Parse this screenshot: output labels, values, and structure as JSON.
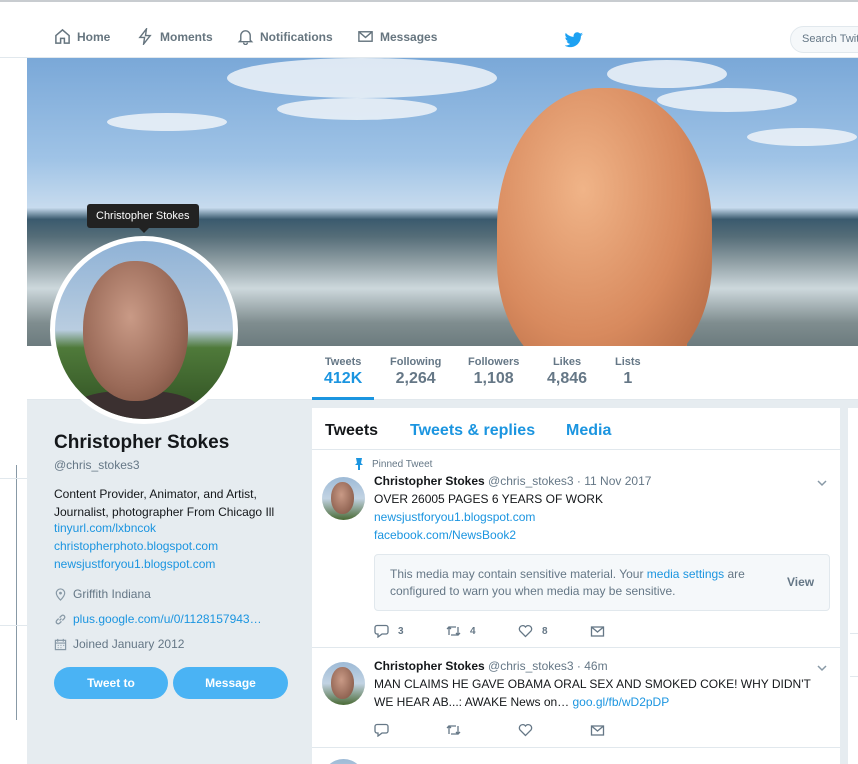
{
  "nav": {
    "home": "Home",
    "moments": "Moments",
    "notifications": "Notifications",
    "messages": "Messages",
    "search_placeholder": "Search Twit"
  },
  "tooltip": "Christopher Stokes",
  "stats": [
    {
      "label": "Tweets",
      "value": "412K"
    },
    {
      "label": "Following",
      "value": "2,264"
    },
    {
      "label": "Followers",
      "value": "1,108"
    },
    {
      "label": "Likes",
      "value": "4,846"
    },
    {
      "label": "Lists",
      "value": "1"
    }
  ],
  "profile": {
    "name": "Christopher Stokes",
    "handle": "@chris_stokes3",
    "bio": "Content Provider, Animator, and Artist, Journalist, photographer From Chicago Ill",
    "links": [
      "tinyurl.com/lxbncok",
      "christopherphoto.blogspot.com",
      "newsjustforyou1.blogspot.com"
    ],
    "location": "Griffith Indiana",
    "website": "plus.google.com/u/0/1128157943…",
    "joined": "Joined January 2012",
    "tweet_to": "Tweet to",
    "message": "Message"
  },
  "tabs": {
    "tweets": "Tweets",
    "replies": "Tweets & replies",
    "media": "Media"
  },
  "tweets": [
    {
      "pinned_label": "Pinned Tweet",
      "name": "Christopher Stokes",
      "meta": "@chris_stokes3 · 11 Nov 2017",
      "text": "OVER 26005 PAGES 6 YEARS OF WORK",
      "link1": "newsjustforyou1.blogspot.com",
      "link2": "facebook.com/NewsBook2",
      "sensitive_pre": "This media may contain sensitive material. Your ",
      "sensitive_link": "media settings",
      "sensitive_post": " are configured to warn you when media may be sensitive.",
      "view": "View",
      "replies": "3",
      "retweets": "4",
      "likes": "8"
    },
    {
      "name": "Christopher Stokes",
      "meta": "@chris_stokes3 · 46m",
      "text": "MAN CLAIMS HE GAVE OBAMA ORAL SEX AND SMOKED COKE! WHY DIDN'T WE HEAR AB...: AWAKE News on… ",
      "link": "goo.gl/fb/wD2pDP"
    }
  ],
  "colors": {
    "accent": "#1b95e0",
    "button": "#4ab3f4",
    "bg": "#e6ecf0"
  }
}
